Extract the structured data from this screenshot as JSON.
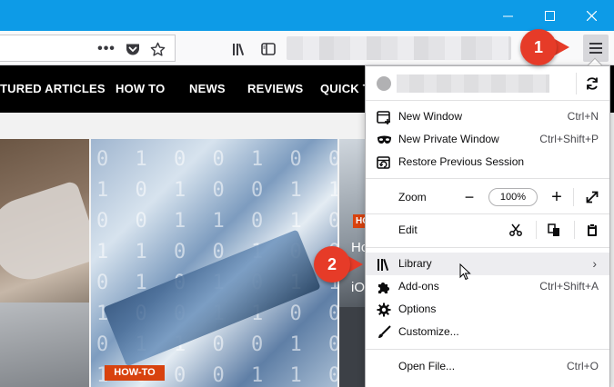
{
  "window": {
    "controls": {
      "minimize": "minimize-icon",
      "maximize": "maximize-icon",
      "close": "close-icon"
    },
    "accent": "#0d9be7"
  },
  "toolbar": {
    "more_label": "•••",
    "icons": [
      "pocket-icon",
      "star-icon",
      "library-icon",
      "sidebar-icon",
      "hamburger-menu-icon"
    ]
  },
  "site_nav": {
    "items": [
      "TURED ARTICLES",
      "HOW TO",
      "NEWS",
      "REVIEWS",
      "QUICK T"
    ]
  },
  "content": {
    "badge_howto": "HOW-TO",
    "badge_small": "HO",
    "card3_text": "Ho\n\niO"
  },
  "menu": {
    "items": [
      {
        "label": "New Window",
        "shortcut": "Ctrl+N",
        "icon": "new-window-icon"
      },
      {
        "label": "New Private Window",
        "shortcut": "Ctrl+Shift+P",
        "icon": "private-mask-icon"
      },
      {
        "label": "Restore Previous Session",
        "shortcut": "",
        "icon": "restore-session-icon"
      }
    ],
    "zoom": {
      "label": "Zoom",
      "minus": "−",
      "value": "100%",
      "plus": "+"
    },
    "edit": {
      "label": "Edit"
    },
    "lower_items": [
      {
        "label": "Library",
        "shortcut": "",
        "icon": "library-icon",
        "submenu": "›"
      },
      {
        "label": "Add-ons",
        "shortcut": "Ctrl+Shift+A",
        "icon": "puzzle-icon"
      },
      {
        "label": "Options",
        "shortcut": "",
        "icon": "gear-icon"
      },
      {
        "label": "Customize...",
        "shortcut": "",
        "icon": "paintbrush-icon"
      }
    ],
    "file_items": [
      {
        "label": "Open File...",
        "shortcut": "Ctrl+O"
      }
    ]
  },
  "callouts": {
    "one": "1",
    "two": "2",
    "color": "#e63b28"
  }
}
